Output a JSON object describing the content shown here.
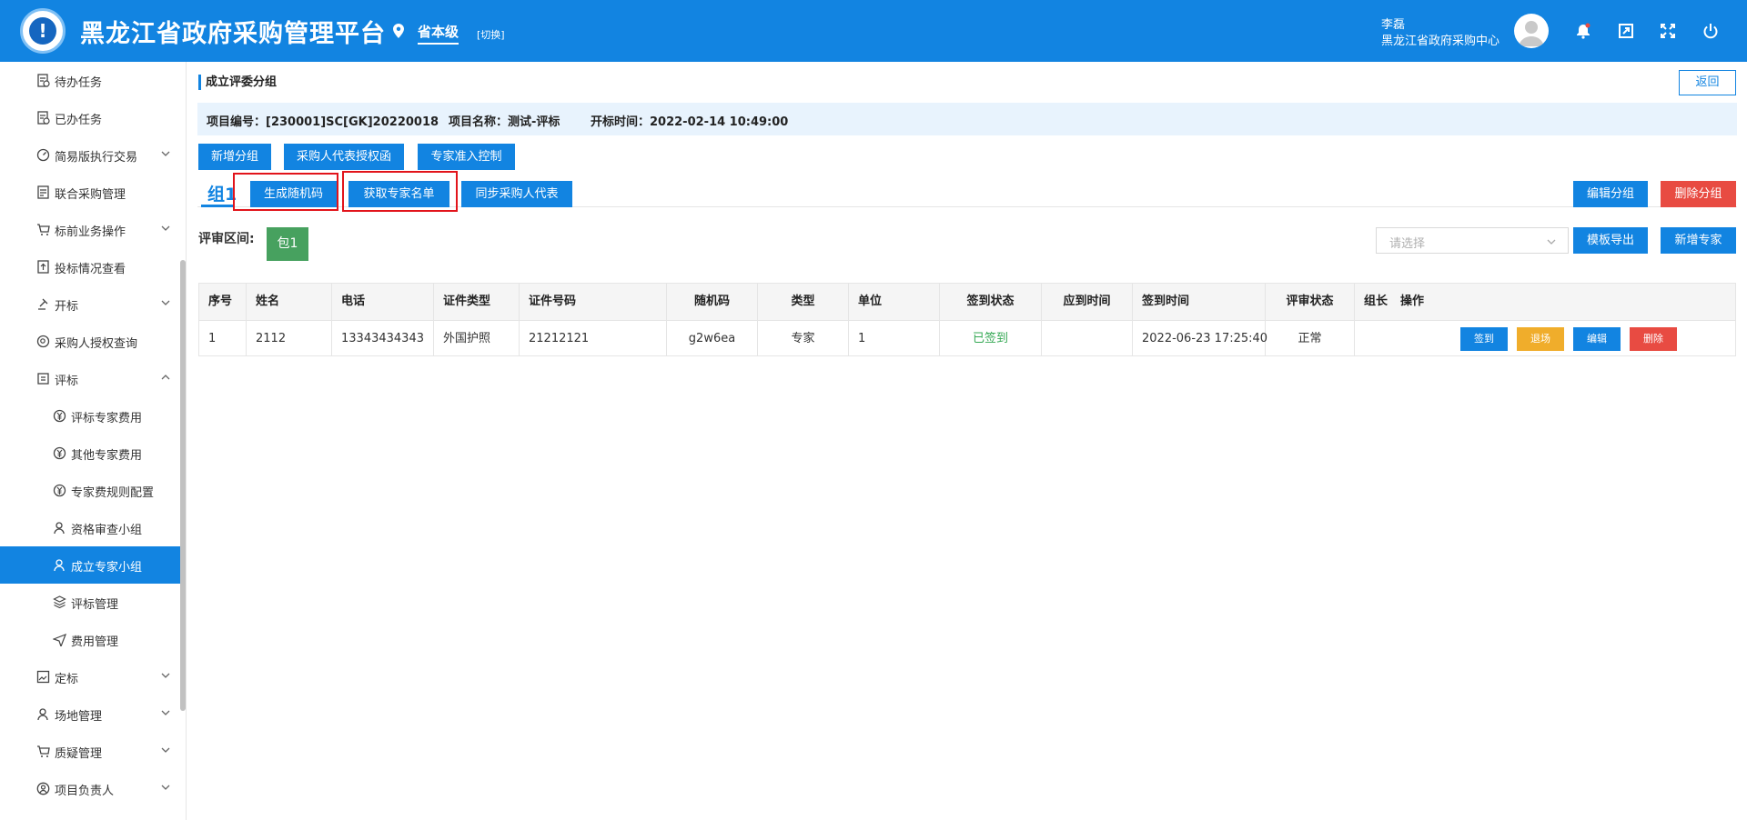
{
  "header": {
    "app_title": "黑龙江省政府采购管理平台",
    "level": "省本级",
    "switch": "[切换]",
    "user_name": "李磊",
    "user_org": "黑龙江省政府采购中心"
  },
  "sidebar": {
    "items": [
      {
        "label": "待办任务"
      },
      {
        "label": "已办任务"
      },
      {
        "label": "简易版执行交易"
      },
      {
        "label": "联合采购管理"
      },
      {
        "label": "标前业务操作"
      },
      {
        "label": "投标情况查看"
      },
      {
        "label": "开标"
      },
      {
        "label": "采购人授权查询"
      },
      {
        "label": "评标"
      },
      {
        "label": "评标专家费用"
      },
      {
        "label": "其他专家费用"
      },
      {
        "label": "专家费规则配置"
      },
      {
        "label": "资格审查小组"
      },
      {
        "label": "成立专家小组"
      },
      {
        "label": "评标管理"
      },
      {
        "label": "费用管理"
      },
      {
        "label": "定标"
      },
      {
        "label": "场地管理"
      },
      {
        "label": "质疑管理"
      },
      {
        "label": "项目负责人"
      }
    ]
  },
  "page": {
    "title": "成立评委分组",
    "back": "返回"
  },
  "info": {
    "project_no": "项目编号：[230001]SC[GK]20220018",
    "project_name": "项目名称：测试-评标",
    "open_time": "开标时间：2022-02-14 10:49:00"
  },
  "toolbar": {
    "add_group": "新增分组",
    "purchaser_auth": "采购人代表授权函",
    "expert_access": "专家准入控制",
    "gen_random": "生成随机码",
    "get_experts": "获取专家名单",
    "sync_purchaser": "同步采购人代表",
    "edit_group": "编辑分组",
    "delete_group": "删除分组",
    "template_export": "模板导出",
    "add_expert": "新增专家"
  },
  "group": {
    "tab": "组1",
    "range_label": "评审区间:",
    "package": "包1",
    "select_placeholder": "请选择"
  },
  "table": {
    "headers": [
      "序号",
      "姓名",
      "电话",
      "证件类型",
      "证件号码",
      "随机码",
      "类型",
      "单位",
      "签到状态",
      "应到时间",
      "签到时间",
      "评审状态",
      "组长",
      "操作"
    ],
    "rows": [
      {
        "cells": [
          "1",
          "2112",
          "13343434343",
          "外国护照",
          "21212121",
          "g2w6ea",
          "专家",
          "1",
          "已签到",
          "",
          "2022-06-23 17:25:40",
          "正常",
          ""
        ],
        "actions": [
          "签到",
          "退场",
          "编辑",
          "删除"
        ]
      }
    ]
  },
  "colors": {
    "primary": "#1284e1",
    "danger": "#e84b42",
    "warning": "#f0ad2b",
    "success": "#47a15f",
    "highlight": "#e2141b"
  }
}
